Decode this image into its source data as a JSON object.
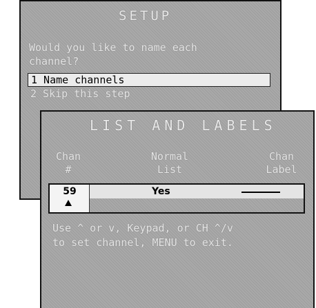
{
  "setup": {
    "title": "SETUP",
    "question_line1": "Would you like to name each",
    "question_line2": "channel?",
    "options": [
      "1 Name channels",
      "2 Skip this step"
    ]
  },
  "lists": {
    "title": "LIST AND LABELS",
    "headers": {
      "chan_top": "Chan",
      "chan_bottom": "#",
      "normal_top": "Normal",
      "normal_bottom": "List",
      "label_top": "Chan",
      "label_bottom": "Label"
    },
    "row": {
      "channel": "59",
      "normal_list": "Yes"
    },
    "instructions_line1": "Use ^ or v, Keypad, or CH ^/v",
    "instructions_line2": "to set channel, MENU to exit."
  }
}
